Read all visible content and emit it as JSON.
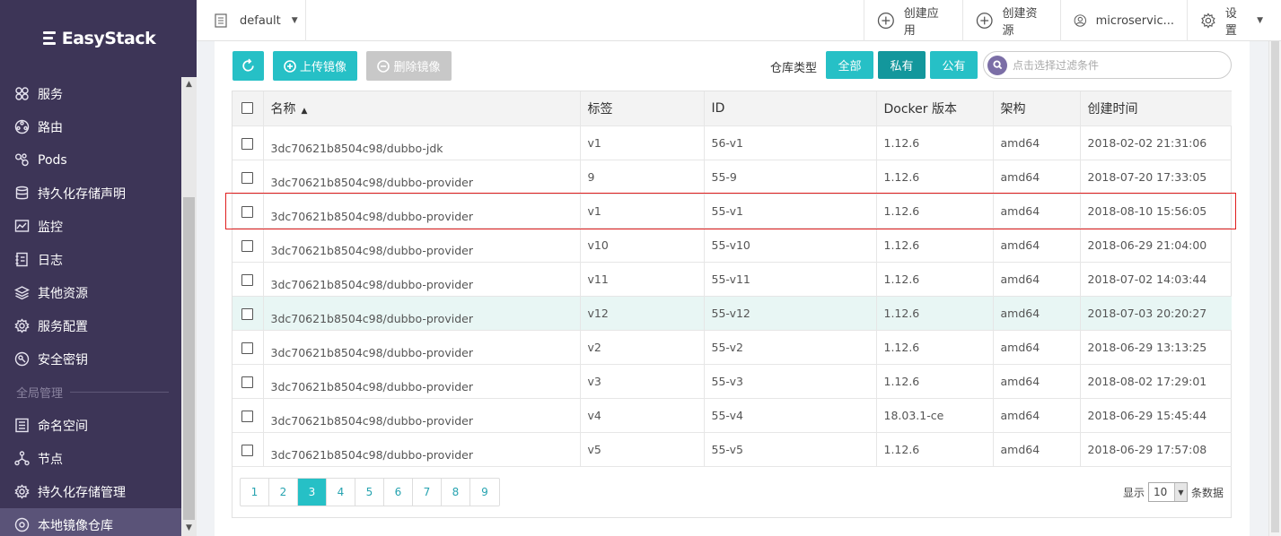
{
  "app": {
    "logo_text": "EasyStack"
  },
  "sidebar": {
    "items": [
      {
        "label": "服务",
        "icon": "services-icon"
      },
      {
        "label": "路由",
        "icon": "route-icon"
      },
      {
        "label": "Pods",
        "icon": "pods-icon"
      },
      {
        "label": "持久化存储声明",
        "icon": "storage-claim-icon"
      },
      {
        "label": "监控",
        "icon": "monitor-icon"
      },
      {
        "label": "日志",
        "icon": "log-icon"
      },
      {
        "label": "其他资源",
        "icon": "layers-icon"
      },
      {
        "label": "服务配置",
        "icon": "config-icon"
      },
      {
        "label": "安全密钥",
        "icon": "key-icon"
      }
    ],
    "section_label": "全局管理",
    "global_items": [
      {
        "label": "命名空间",
        "icon": "namespace-icon"
      },
      {
        "label": "节点",
        "icon": "node-icon"
      },
      {
        "label": "持久化存储管理",
        "icon": "storage-manage-icon"
      },
      {
        "label": "本地镜像仓库",
        "icon": "image-repo-icon",
        "active": true
      }
    ]
  },
  "topbar": {
    "namespace": "default",
    "create_app": "创建应用",
    "create_resource": "创建资源",
    "user": "microservic...",
    "settings": "设置"
  },
  "toolbar": {
    "upload_label": "上传镜像",
    "delete_label": "删除镜像",
    "repo_type_label": "仓库类型",
    "seg_all": "全部",
    "seg_private": "私有",
    "seg_public": "公有",
    "filter_placeholder": "点击选择过滤条件"
  },
  "table": {
    "columns": [
      "名称",
      "标签",
      "ID",
      "Docker 版本",
      "架构",
      "创建时间"
    ],
    "rows": [
      {
        "name": "3dc70621b8504c98/dubbo-jdk",
        "tag": "v1",
        "id": "56-v1",
        "docker": "1.12.6",
        "arch": "amd64",
        "created": "2018-02-02 21:31:06"
      },
      {
        "name": "3dc70621b8504c98/dubbo-provider",
        "tag": "9",
        "id": "55-9",
        "docker": "1.12.6",
        "arch": "amd64",
        "created": "2018-07-20 17:33:05"
      },
      {
        "name": "3dc70621b8504c98/dubbo-provider",
        "tag": "v1",
        "id": "55-v1",
        "docker": "1.12.6",
        "arch": "amd64",
        "created": "2018-08-10 15:56:05"
      },
      {
        "name": "3dc70621b8504c98/dubbo-provider",
        "tag": "v10",
        "id": "55-v10",
        "docker": "1.12.6",
        "arch": "amd64",
        "created": "2018-06-29 21:04:00"
      },
      {
        "name": "3dc70621b8504c98/dubbo-provider",
        "tag": "v11",
        "id": "55-v11",
        "docker": "1.12.6",
        "arch": "amd64",
        "created": "2018-07-02 14:03:44"
      },
      {
        "name": "3dc70621b8504c98/dubbo-provider",
        "tag": "v12",
        "id": "55-v12",
        "docker": "1.12.6",
        "arch": "amd64",
        "created": "2018-07-03 20:20:27"
      },
      {
        "name": "3dc70621b8504c98/dubbo-provider",
        "tag": "v2",
        "id": "55-v2",
        "docker": "1.12.6",
        "arch": "amd64",
        "created": "2018-06-29 13:13:25"
      },
      {
        "name": "3dc70621b8504c98/dubbo-provider",
        "tag": "v3",
        "id": "55-v3",
        "docker": "1.12.6",
        "arch": "amd64",
        "created": "2018-08-02 17:29:01"
      },
      {
        "name": "3dc70621b8504c98/dubbo-provider",
        "tag": "v4",
        "id": "55-v4",
        "docker": "18.03.1-ce",
        "arch": "amd64",
        "created": "2018-06-29 15:45:44"
      },
      {
        "name": "3dc70621b8504c98/dubbo-provider",
        "tag": "v5",
        "id": "55-v5",
        "docker": "1.12.6",
        "arch": "amd64",
        "created": "2018-06-29 17:57:08"
      }
    ]
  },
  "pagination": {
    "pages": [
      "1",
      "2",
      "3",
      "4",
      "5",
      "6",
      "7",
      "8",
      "9"
    ],
    "current": "3",
    "show_label": "显示",
    "page_size": "10",
    "suffix_label": "条数据"
  },
  "colors": {
    "accent": "#26c0c6",
    "sidebar": "#3d3557",
    "highlight_border": "#e01e1e",
    "row_hover": "#e8f6f4"
  }
}
